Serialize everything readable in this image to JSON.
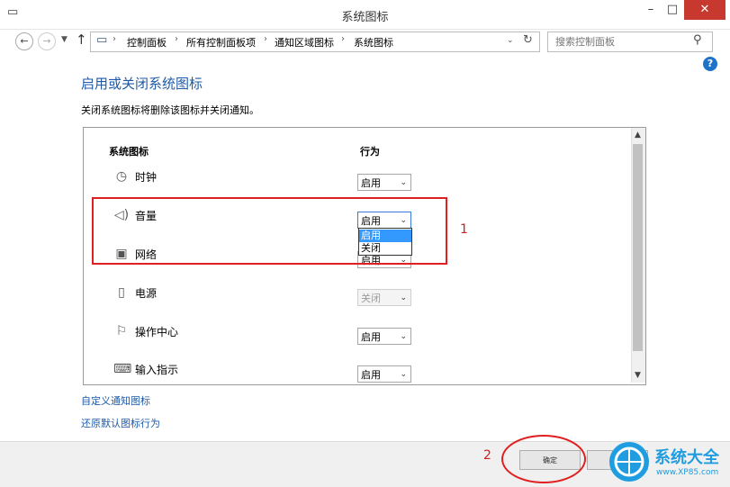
{
  "window": {
    "title": "系统图标",
    "minimize_glyph": "–",
    "maximize_glyph": "□",
    "close_glyph": "✕"
  },
  "addressbar": {
    "back_icon": "back-arrow-icon",
    "forward_icon": "forward-arrow-icon",
    "breadcrumbs": [
      "控制面板",
      "所有控制面板项",
      "通知区域图标",
      "系统图标"
    ],
    "search_placeholder": "搜索控制面板"
  },
  "main": {
    "heading": "启用或关闭系统图标",
    "description": "关闭系统图标将删除该图标并关闭通知。",
    "columns": {
      "icon": "系统图标",
      "behavior": "行为"
    },
    "rows": [
      {
        "label": "时钟",
        "icon": "clock-icon",
        "value": "启用"
      },
      {
        "label": "音量",
        "icon": "volume-icon",
        "value": "启用"
      },
      {
        "label": "网络",
        "icon": "network-icon",
        "value": "启用"
      },
      {
        "label": "电源",
        "icon": "power-icon",
        "value": "关闭"
      },
      {
        "label": "操作中心",
        "icon": "flag-icon",
        "value": "启用"
      },
      {
        "label": "输入指示",
        "icon": "keyboard-icon",
        "value": "启用"
      }
    ],
    "dropdown_options": [
      "启用",
      "关闭"
    ],
    "dropdown_selected": "启用"
  },
  "links": {
    "customize": "自定义通知图标",
    "restore": "还原默认图标行为"
  },
  "footer": {
    "ok_label": "确定"
  },
  "annotations": {
    "marker_1": "1",
    "marker_2": "2",
    "color": "#e02020"
  },
  "watermark": {
    "brand": "系统大全",
    "url": "www.XP85.com",
    "color": "#1f9de0"
  },
  "colors": {
    "heading": "#1e5aa8",
    "close_button": "#c7392f",
    "selected_option": "#3399ff"
  }
}
